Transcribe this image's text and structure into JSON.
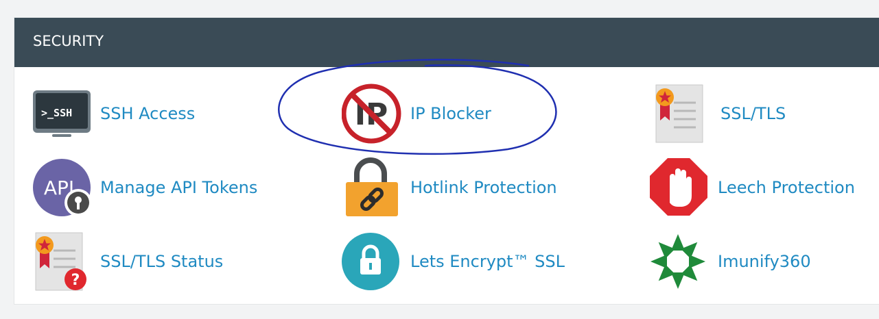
{
  "section": {
    "title": "SECURITY"
  },
  "items": [
    {
      "label": "SSH Access",
      "icon": "ssh-terminal-icon"
    },
    {
      "label": "IP Blocker",
      "icon": "ip-blocker-icon"
    },
    {
      "label": "SSL/TLS",
      "icon": "certificate-icon"
    },
    {
      "label": "Manage API Tokens",
      "icon": "api-token-icon"
    },
    {
      "label": "Hotlink Protection",
      "icon": "padlock-link-icon"
    },
    {
      "label": "Leech Protection",
      "icon": "stop-hand-icon"
    },
    {
      "label": "SSL/TLS Status",
      "icon": "certificate-status-icon"
    },
    {
      "label": "Lets Encrypt™ SSL",
      "icon": "lets-encrypt-lock-icon"
    },
    {
      "label": "Imunify360",
      "icon": "imunify360-icon"
    }
  ],
  "colors": {
    "header_bg": "#3a4b56",
    "link": "#1f8ac2",
    "annotation": "#1f2fb0"
  }
}
